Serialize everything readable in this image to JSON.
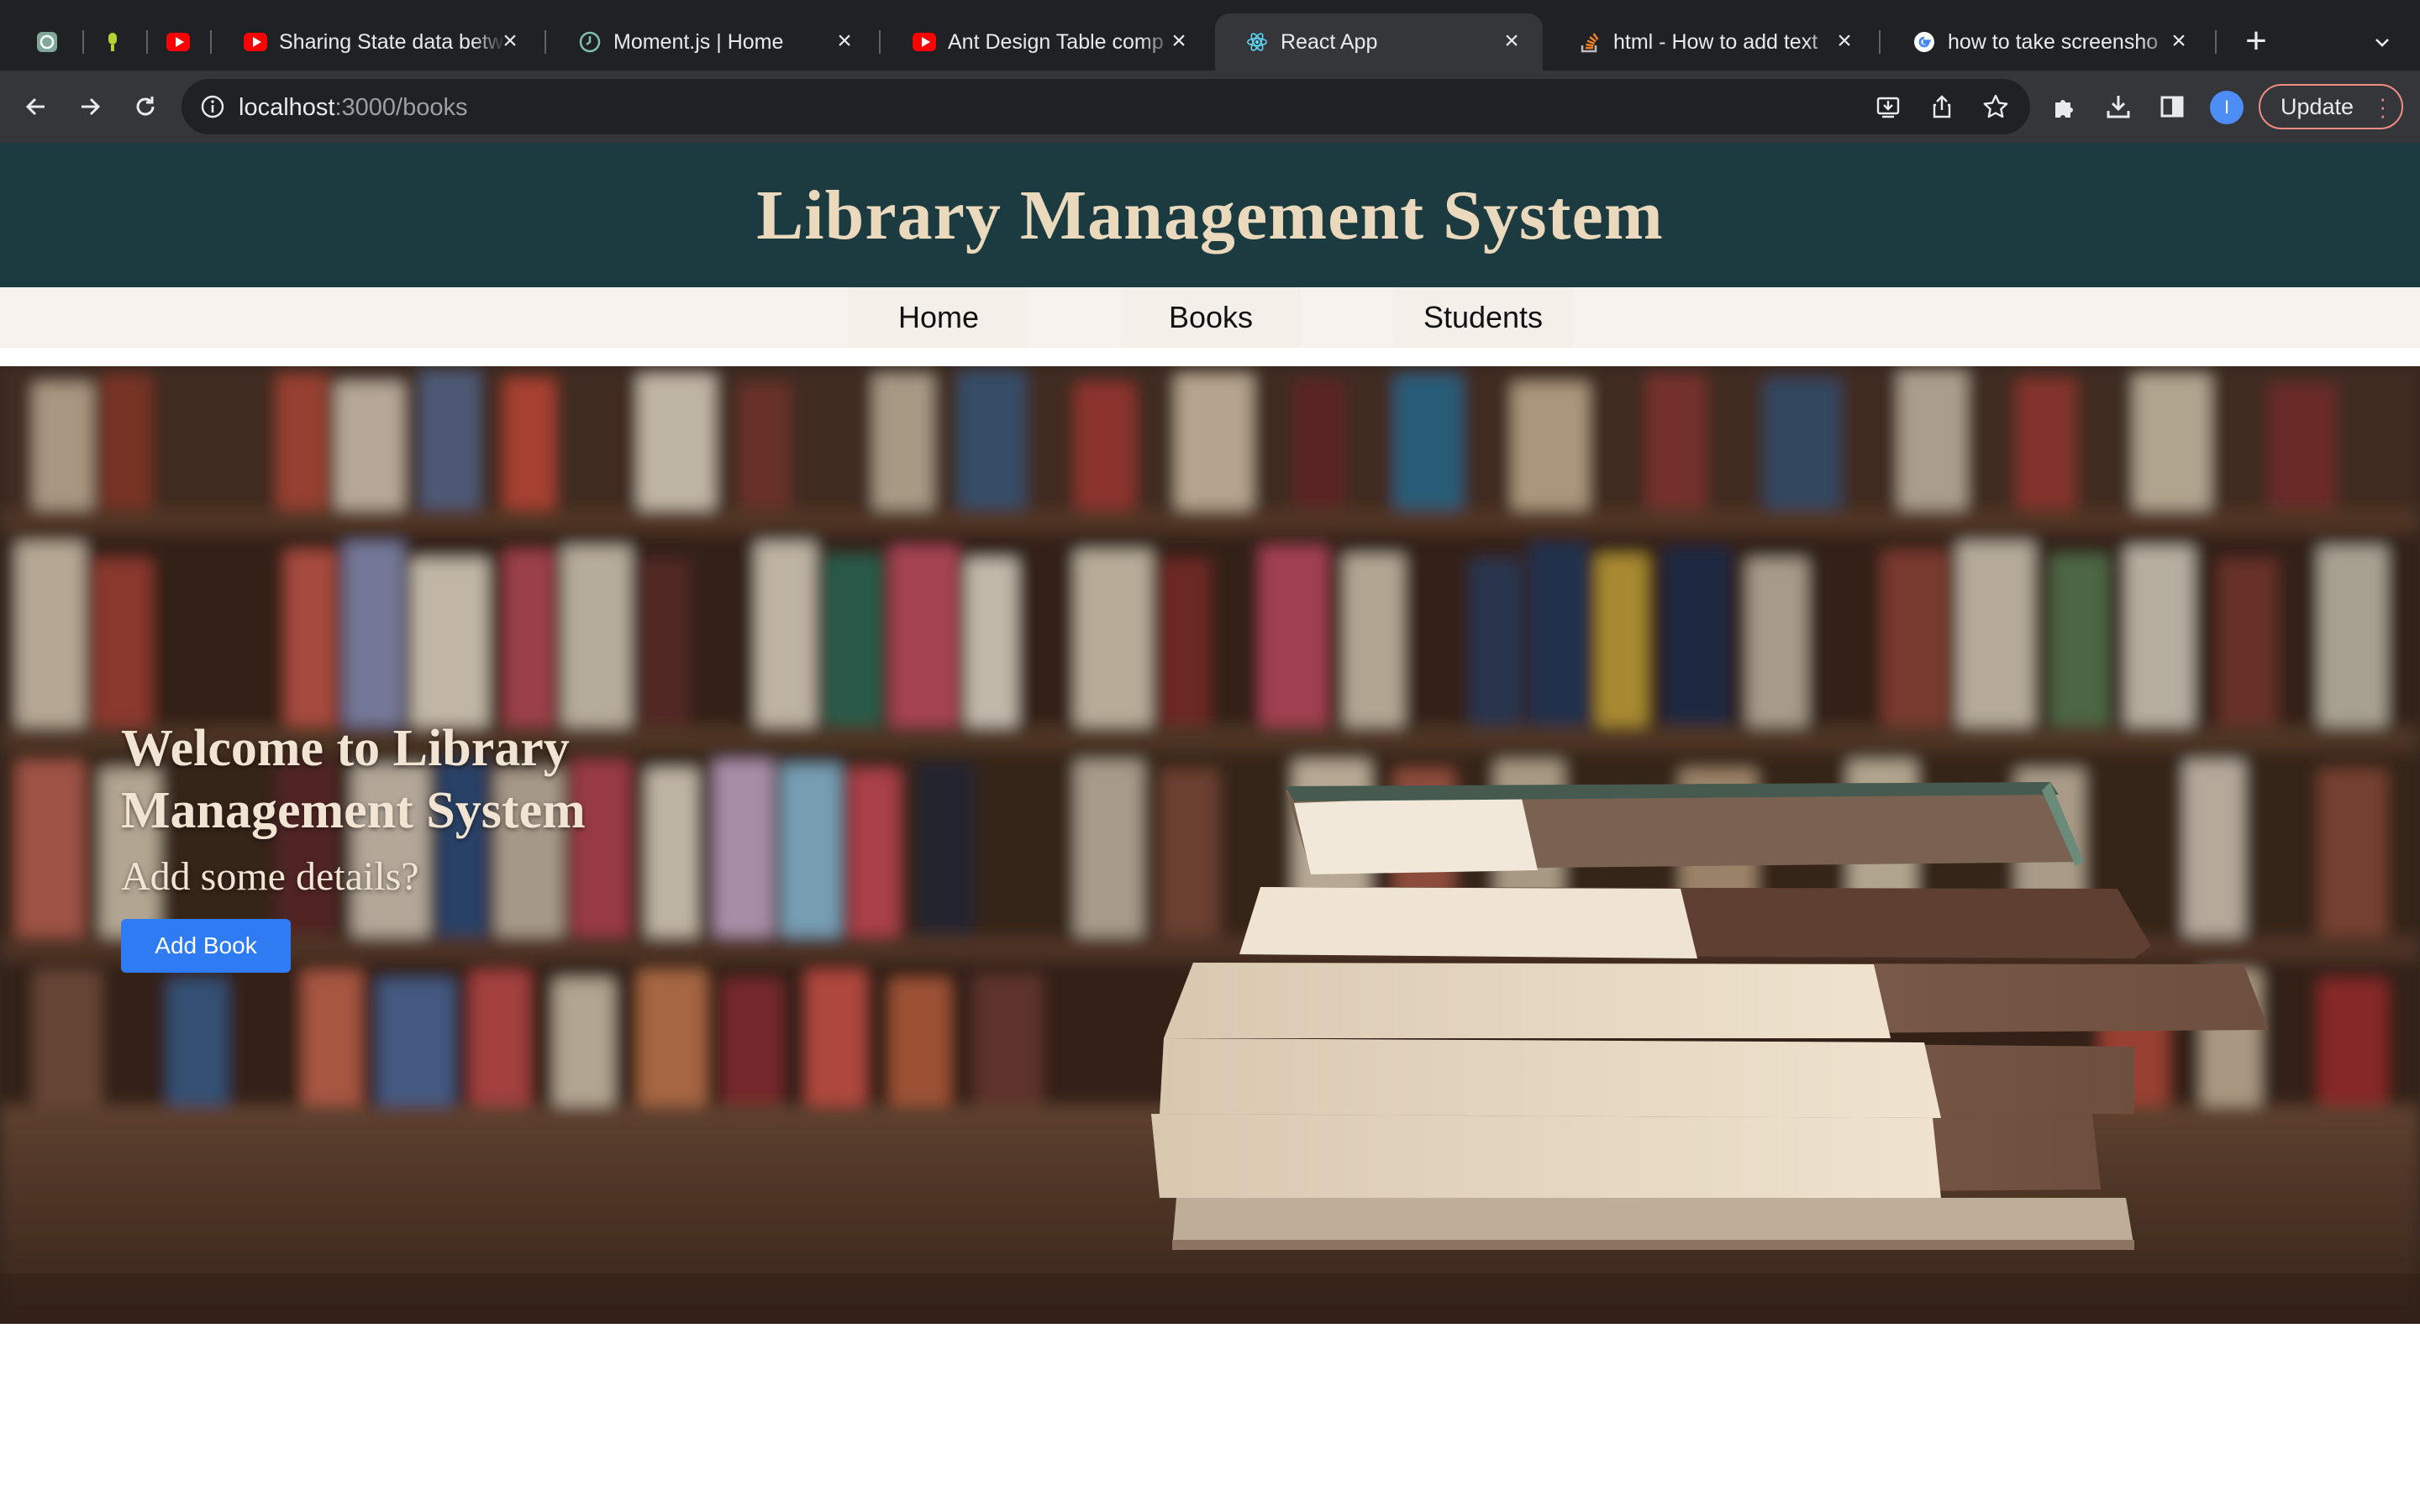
{
  "browser": {
    "tabs": [
      {
        "title": "",
        "icon": "chatgpt-icon",
        "pinned": true
      },
      {
        "title": "",
        "icon": "podcast-icon",
        "pinned": true
      },
      {
        "title": "",
        "icon": "youtube-icon",
        "pinned": true
      },
      {
        "title": "Sharing State data betw",
        "icon": "youtube-icon"
      },
      {
        "title": "Moment.js | Home",
        "icon": "clock-icon"
      },
      {
        "title": "Ant Design Table comp",
        "icon": "youtube-icon"
      },
      {
        "title": "React App",
        "icon": "react-icon",
        "active": true
      },
      {
        "title": "html - How to add text",
        "icon": "stackoverflow-icon"
      },
      {
        "title": "how to take screensho",
        "icon": "google-icon"
      }
    ],
    "url_host": "localhost",
    "url_rest": ":3000/books",
    "profile_initial": "I",
    "update_label": "Update"
  },
  "site": {
    "title": "Library Management System",
    "nav": [
      "Home",
      "Books",
      "Students"
    ]
  },
  "hero": {
    "heading": "Welcome to Library Management System",
    "subtitle": "Add some details?",
    "button_label": "Add Book"
  },
  "colors": {
    "header_bg": "#1b3b40",
    "title_color": "#ead9bd",
    "nav_bg": "#f7f2ee",
    "button_bg": "#2f7bf4"
  }
}
